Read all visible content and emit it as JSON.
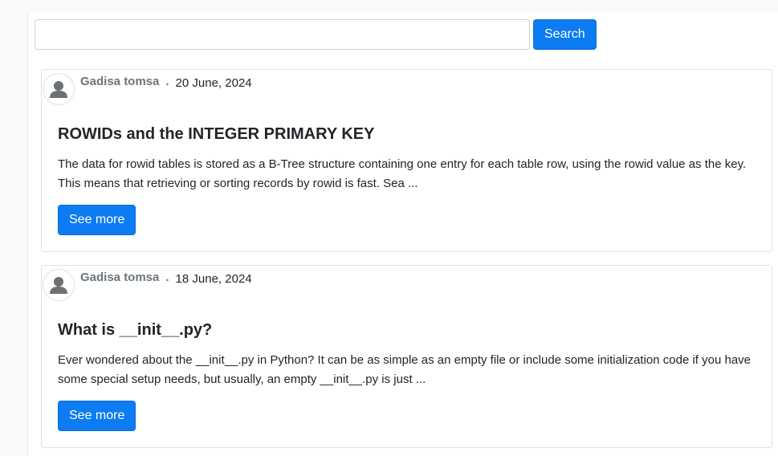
{
  "search": {
    "value": "",
    "placeholder": "",
    "button_label": "Search"
  },
  "posts": [
    {
      "author": "Gadisa tomsa",
      "separator": ".",
      "date": "20 June, 2024",
      "title": "ROWIDs and the INTEGER PRIMARY KEY",
      "excerpt": "The data for rowid tables is stored as a B-Tree structure containing one entry for each table row, using the rowid value as the key. This means that retrieving or sorting records by rowid is fast. Sea ...",
      "button_label": "See more",
      "avatar_icon": "user-avatar-icon"
    },
    {
      "author": "Gadisa tomsa",
      "separator": ".",
      "date": "18 June, 2024",
      "title": "What is __init__.py?",
      "excerpt": "Ever wondered about the __init__.py in Python? It can be as simple as an empty file or include some initialization code if you have some special setup needs, but usually, an empty __init__.py is just ...",
      "button_label": "See more",
      "avatar_icon": "user-avatar-icon"
    }
  ],
  "colors": {
    "primary": "#0d7cf2",
    "muted_text": "#6c757d",
    "body_text": "#212529",
    "border": "#dfe2e6"
  }
}
